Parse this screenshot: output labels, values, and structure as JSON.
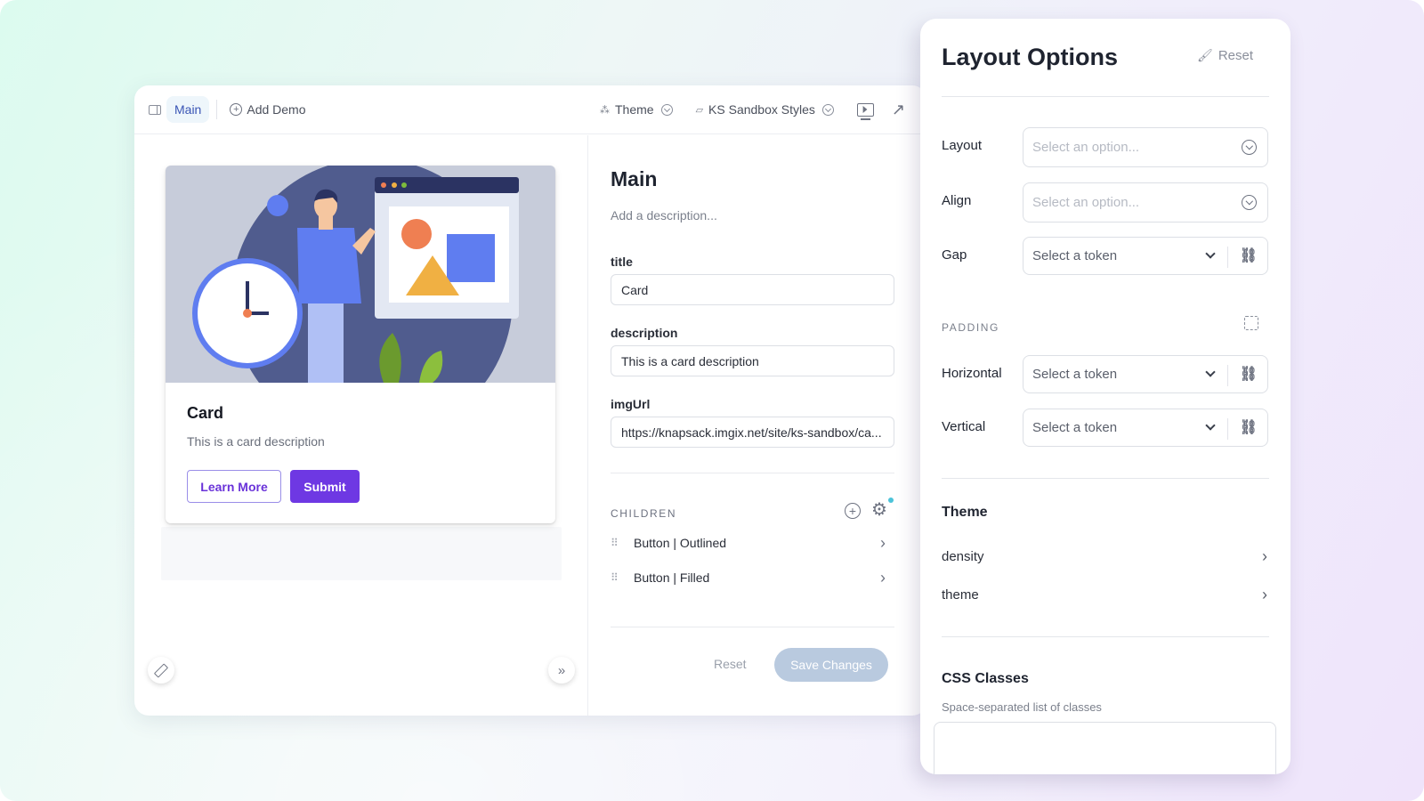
{
  "toolbar": {
    "main_tab": "Main",
    "add_demo": "Add Demo",
    "theme": "Theme",
    "styles": "KS Sandbox Styles"
  },
  "card": {
    "title": "Card",
    "description": "This is a card description",
    "button_outlined": "Learn More",
    "button_filled": "Submit",
    "colors": {
      "primary": "#6e38e3"
    }
  },
  "props": {
    "title": "Main",
    "description_placeholder": "Add a description...",
    "fields": [
      {
        "label": "title",
        "value": "Card"
      },
      {
        "label": "description",
        "value": "This is a card description"
      },
      {
        "label": "imgUrl",
        "value": "https://knapsack.imgix.net/site/ks-sandbox/ca..."
      }
    ],
    "children_header": "CHILDREN",
    "children": [
      {
        "label": "Button | Outlined"
      },
      {
        "label": "Button | Filled"
      }
    ],
    "reset": "Reset",
    "save": "Save Changes"
  },
  "layout_options": {
    "title": "Layout Options",
    "reset": "Reset",
    "layout": {
      "label": "Layout",
      "placeholder": "Select an option..."
    },
    "align": {
      "label": "Align",
      "placeholder": "Select an option..."
    },
    "gap": {
      "label": "Gap",
      "value": "Select a token"
    },
    "padding_header": "PADDING",
    "horizontal": {
      "label": "Horizontal",
      "value": "Select a token"
    },
    "vertical": {
      "label": "Vertical",
      "value": "Select a token"
    },
    "theme_header": "Theme",
    "theme_rows": [
      {
        "label": "density"
      },
      {
        "label": "theme"
      }
    ],
    "css_header": "CSS Classes",
    "css_sub": "Space-separated list of classes",
    "css_value": ""
  }
}
